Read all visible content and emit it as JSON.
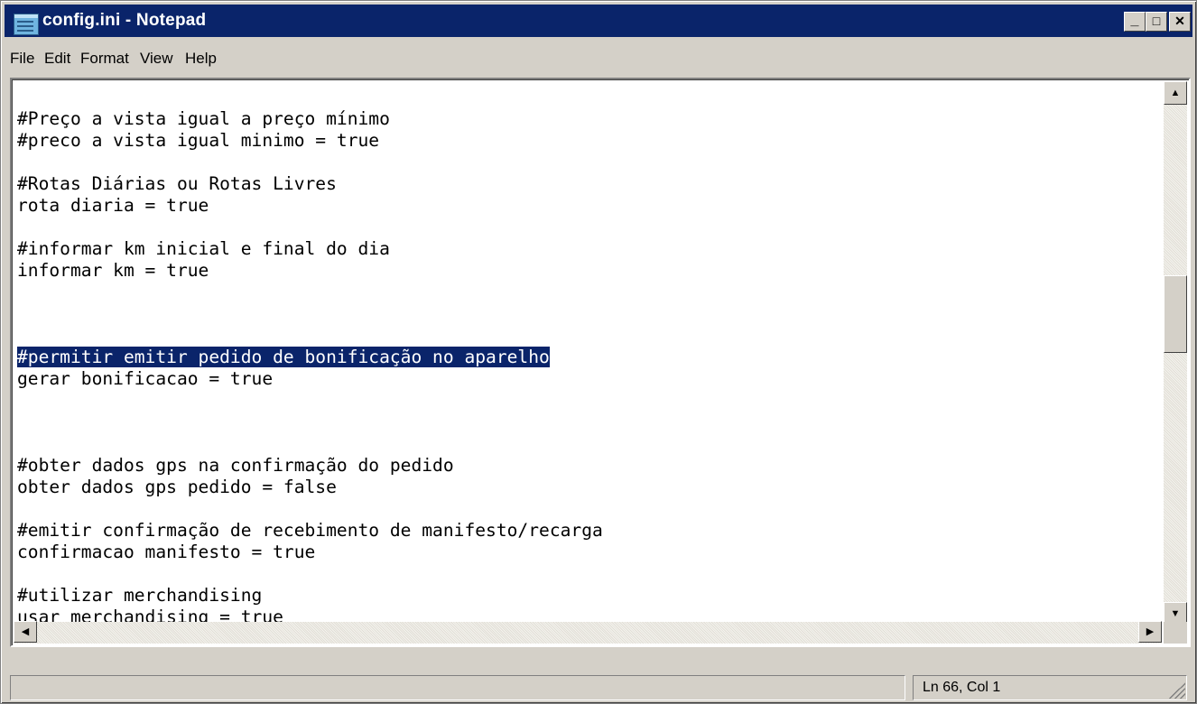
{
  "window": {
    "title": "config.ini - Notepad",
    "controls": {
      "minimize": "_",
      "maximize": "□",
      "close": "✕"
    }
  },
  "menu": [
    "File",
    "Edit",
    "Format",
    "View",
    "Help"
  ],
  "editor": {
    "lines": [
      "",
      "#Preço a vista igual a preço mínimo",
      "#preco a vista igual minimo = true",
      "",
      "#Rotas Diárias ou Rotas Livres",
      "rota diaria = true",
      "",
      "#informar km inicial e final do dia",
      "informar km = true",
      "",
      "",
      "",
      "#permitir emitir pedido de bonificação no aparelho",
      "gerar bonificacao = true",
      "",
      "",
      "",
      "#obter dados gps na confirmação do pedido",
      "obter dados gps pedido = false",
      "",
      "#emitir confirmação de recebimento de manifesto/recarga",
      "confirmacao manifesto = true",
      "",
      "#utilizar merchandising",
      "usar merchandising = true"
    ],
    "selected_line": 12
  },
  "status": {
    "position": "Ln 66, Col 1"
  },
  "colors": {
    "titlebar": "#0a246a",
    "selection": "#0a246a",
    "chrome": "#d4d0c8"
  }
}
